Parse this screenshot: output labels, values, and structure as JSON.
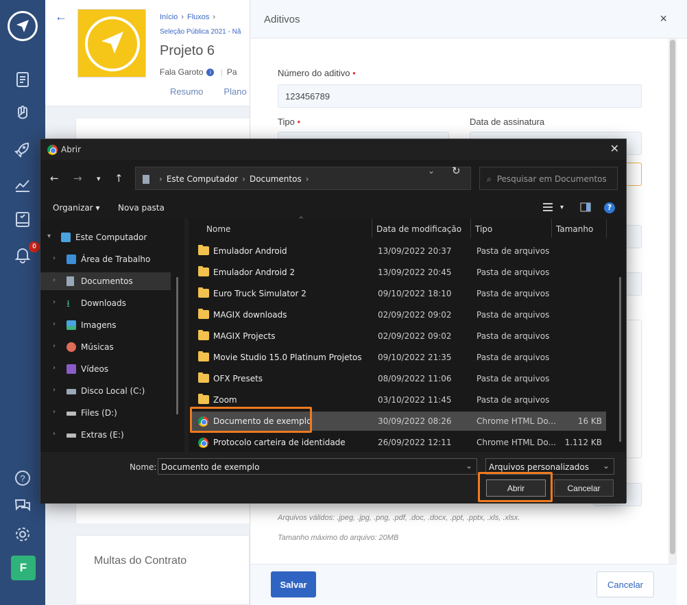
{
  "app": {
    "notification_count": "0",
    "user_initial": "F"
  },
  "project": {
    "breadcrumb": [
      "Início",
      "Fluxos"
    ],
    "breadcrumb2": "Seleção Pública 2021 - Nã",
    "title": "Projeto 6",
    "author": "Fala Garoto",
    "author_tail": "Pa",
    "tabs": [
      "Resumo",
      "Plano"
    ],
    "section_multas": "Multas do Contrato"
  },
  "aditivos": {
    "title": "Aditivos",
    "numero_label": "Número do aditivo",
    "numero_value": "123456789",
    "tipo_label": "Tipo",
    "data_label": "Data de assinatura",
    "hint_formats": "Arquivos válidos: .jpeg, .jpg, .png, .pdf, .doc, .docx, .ppt, .pptx, .xls, .xlsx.",
    "hint_size": "Tamanho máximo do arquivo: 20MB",
    "save_label": "Salvar",
    "cancel_label": "Cancelar"
  },
  "dialog": {
    "title": "Abrir",
    "address": [
      "Este Computador",
      "Documentos"
    ],
    "search_placeholder": "Pesquisar em Documentos",
    "organize_label": "Organizar",
    "new_folder_label": "Nova pasta",
    "tree": [
      {
        "label": "Este Computador",
        "icon": "computer-icon"
      },
      {
        "label": "Área de Trabalho",
        "icon": "desktop-icon"
      },
      {
        "label": "Documentos",
        "icon": "documents-icon"
      },
      {
        "label": "Downloads",
        "icon": "download-icon"
      },
      {
        "label": "Imagens",
        "icon": "images-icon"
      },
      {
        "label": "Músicas",
        "icon": "music-icon"
      },
      {
        "label": "Vídeos",
        "icon": "video-icon"
      },
      {
        "label": "Disco Local (C:)",
        "icon": "drive-icon"
      },
      {
        "label": "Files (D:)",
        "icon": "drive-icon"
      },
      {
        "label": "Extras (E:)",
        "icon": "drive-icon"
      }
    ],
    "columns": [
      "Nome",
      "Data de modificação",
      "Tipo",
      "Tamanho"
    ],
    "files": [
      {
        "name": "Emulador Android",
        "date": "13/09/2022 20:37",
        "type": "Pasta de arquivos",
        "size": "",
        "icon": "folder-icon"
      },
      {
        "name": "Emulador Android 2",
        "date": "13/09/2022 20:45",
        "type": "Pasta de arquivos",
        "size": "",
        "icon": "folder-icon"
      },
      {
        "name": "Euro Truck Simulator 2",
        "date": "09/10/2022 18:10",
        "type": "Pasta de arquivos",
        "size": "",
        "icon": "folder-icon"
      },
      {
        "name": "MAGIX downloads",
        "date": "02/09/2022 09:02",
        "type": "Pasta de arquivos",
        "size": "",
        "icon": "folder-icon"
      },
      {
        "name": "MAGIX Projects",
        "date": "02/09/2022 09:02",
        "type": "Pasta de arquivos",
        "size": "",
        "icon": "folder-icon"
      },
      {
        "name": "Movie Studio 15.0 Platinum Projetos",
        "date": "09/10/2022 21:35",
        "type": "Pasta de arquivos",
        "size": "",
        "icon": "folder-icon"
      },
      {
        "name": "OFX Presets",
        "date": "08/09/2022 11:06",
        "type": "Pasta de arquivos",
        "size": "",
        "icon": "folder-icon"
      },
      {
        "name": "Zoom",
        "date": "03/10/2022 11:45",
        "type": "Pasta de arquivos",
        "size": "",
        "icon": "folder-icon"
      },
      {
        "name": "Documento de exemplo",
        "date": "30/09/2022 08:26",
        "type": "Chrome HTML Do...",
        "size": "16 KB",
        "icon": "chrome-icon"
      },
      {
        "name": "Protocolo carteira de identidade",
        "date": "26/09/2022 12:11",
        "type": "Chrome HTML Do...",
        "size": "1.112 KB",
        "icon": "chrome-icon"
      }
    ],
    "name_label": "Nome:",
    "file_name_value": "Documento de exemplo",
    "filter_value": "Arquivos personalizados",
    "open_label": "Abrir",
    "cancel_label": "Cancelar"
  }
}
